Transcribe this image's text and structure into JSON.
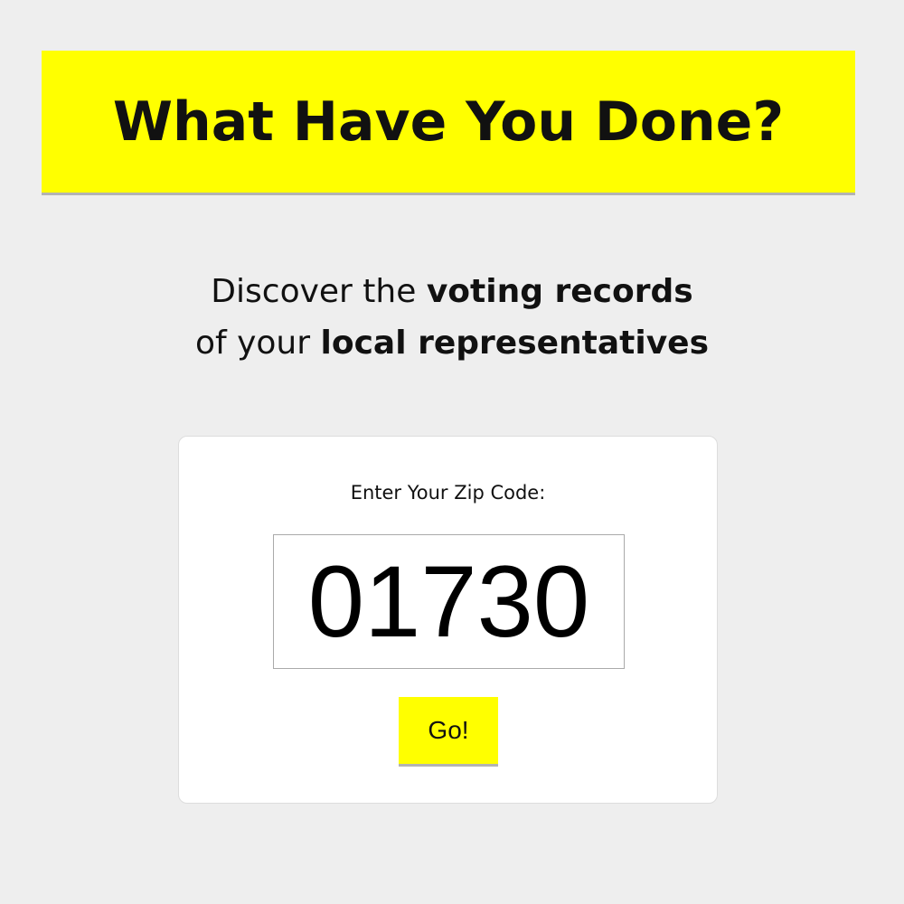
{
  "header": {
    "title": "What Have You Done?"
  },
  "tagline": {
    "line1_plain": "Discover the ",
    "line1_bold": "voting records",
    "line2_plain": "of your ",
    "line2_bold": "local representatives"
  },
  "zip_form": {
    "label": "Enter Your Zip Code:",
    "value": "01730",
    "button_label": "Go!"
  },
  "colors": {
    "accent": "#ffff00",
    "background": "#eeeeee"
  }
}
